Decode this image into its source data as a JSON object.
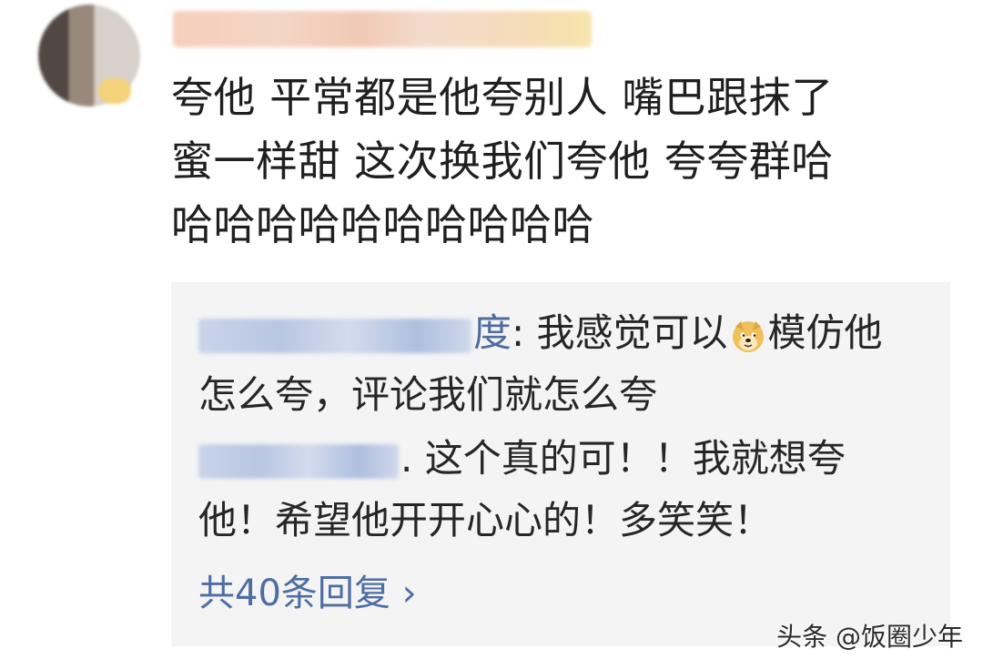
{
  "comment": {
    "lines": [
      "夸他  平常都是他夸别人 嘴巴跟抹了",
      "蜜一样甜 这次换我们夸他  夸夸群哈",
      "哈哈哈哈哈哈哈哈哈哈"
    ]
  },
  "replies": [
    {
      "author_tail": "度",
      "separator": ": ",
      "text_line1": "我感觉可以",
      "emoji": "doge-emoji",
      "text_line1_after": "模仿他",
      "text_line2": "怎么夸，评论我们就怎么夸"
    },
    {
      "author_tail": "",
      "separator": ". ",
      "text_line1": "这个真的可！！我就想夸",
      "text_line2": "他！希望他开开心心的！多笑笑！"
    }
  ],
  "more_replies": {
    "label": "共40条回复 ›"
  },
  "watermark": {
    "text": "头条 @饭圈少年"
  },
  "colors": {
    "link": "#4d6ea3",
    "reply_bg": "#f4f4f4",
    "text": "#1f1f1f"
  }
}
